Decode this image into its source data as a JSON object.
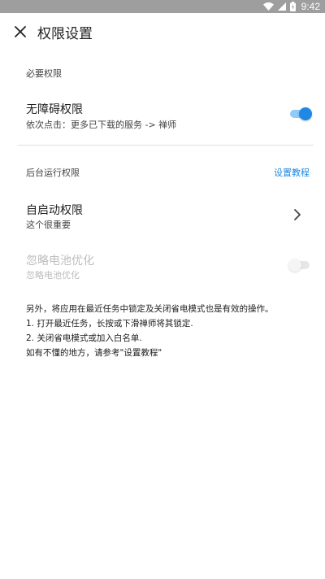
{
  "status_bar": {
    "time": "9:42",
    "icons": [
      "wifi-icon",
      "signal-icon",
      "battery-icon"
    ]
  },
  "toolbar": {
    "title": "权限设置",
    "close_icon": "close-icon"
  },
  "sections": {
    "required": {
      "header": "必要权限",
      "accessibility": {
        "title": "无障碍权限",
        "subtitle": "依次点击：更多已下载的服务 -> 禅师",
        "enabled": true
      }
    },
    "background": {
      "header": "后台运行权限",
      "tutorial_link": "设置教程",
      "autostart": {
        "title": "自启动权限",
        "subtitle": "这个很重要",
        "icon": "chevron-right-icon"
      },
      "battery": {
        "title": "忽略电池优化",
        "subtitle": "忽略电池优化",
        "enabled": false,
        "disabled": true
      }
    }
  },
  "note": {
    "lines": [
      "另外，将应用在最近任务中锁定及关闭省电模式也是有效的操作。",
      "1. 打开最近任务，长按或下滑禅师将其锁定.",
      "2. 关闭省电模式或加入白名单.",
      "如有不懂的地方，请参考\"设置教程\""
    ]
  },
  "colors": {
    "accent": "#1e88e5",
    "accent_track": "#90caf9",
    "status_bar": "#9e9e9e",
    "divider": "#e0e0e0",
    "disabled_text": "#bdbdbd"
  }
}
